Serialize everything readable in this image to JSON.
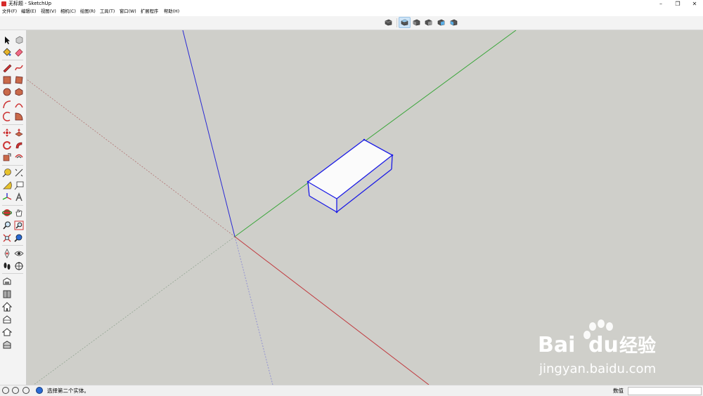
{
  "window": {
    "title": "无标题 - SketchUp",
    "controls": {
      "minimize": "–",
      "restore": "❐",
      "close": "✕"
    }
  },
  "menubar": {
    "items": [
      "文件(F)",
      "编辑(E)",
      "视图(V)",
      "相机(C)",
      "绘图(R)",
      "工具(T)",
      "窗口(W)",
      "扩展程序",
      "帮助(H)"
    ]
  },
  "view_toolbar": {
    "buttons": [
      {
        "name": "iso-view",
        "selected": false
      },
      {
        "name": "top-view",
        "selected": true
      },
      {
        "name": "front-view",
        "selected": false
      },
      {
        "name": "right-view",
        "selected": false
      },
      {
        "name": "back-view",
        "selected": false
      },
      {
        "name": "left-view",
        "selected": false
      }
    ]
  },
  "left_toolbar": {
    "tools": [
      "select",
      "component",
      "paint-bucket",
      "eraser",
      "line",
      "freehand",
      "rectangle",
      "rotated-rectangle",
      "circle",
      "polygon",
      "arc",
      "two-point-arc",
      "three-point-arc",
      "pie",
      "move",
      "push-pull",
      "rotate",
      "follow-me",
      "scale",
      "offset",
      "tape-measure",
      "dimension",
      "protractor",
      "text",
      "axes",
      "3d-text",
      "orbit",
      "pan",
      "zoom",
      "zoom-window",
      "zoom-extents",
      "previous-view",
      "position-camera",
      "look-around",
      "walk",
      "section-plane",
      "warehouse",
      "extension-warehouse",
      "house",
      "component-upload",
      "sandbox",
      "layer-out"
    ]
  },
  "scene": {
    "axis_colors": {
      "red": "#c0393e",
      "green": "#3aa63a",
      "blue": "#2a2ad4"
    },
    "selection_color": "#1a1ae6",
    "background": "#cfcfca",
    "object": "box"
  },
  "statusbar": {
    "message": "选择第二个实体。",
    "measure_label": "数值",
    "measure_value": ""
  },
  "watermark": {
    "brand_left": "Bai",
    "brand_right": "du",
    "suffix": "经验",
    "url": "jingyan.baidu.com"
  }
}
